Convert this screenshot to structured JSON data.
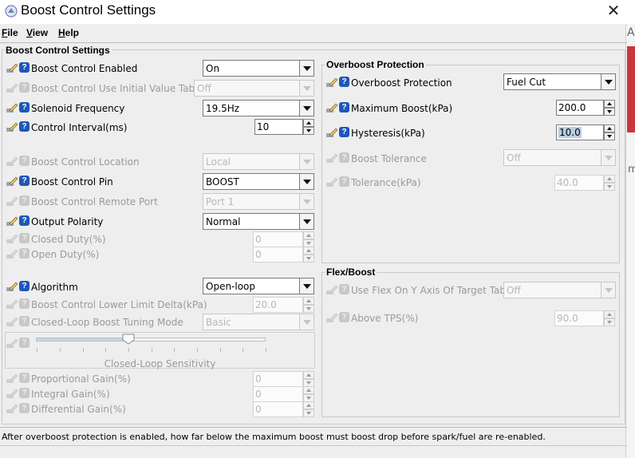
{
  "window": {
    "title": "Boost Control Settings",
    "close_glyph": "✕"
  },
  "menu": [
    {
      "key": "F",
      "rest": "ile"
    },
    {
      "key": "V",
      "rest": "iew"
    },
    {
      "key": "H",
      "rest": "elp"
    }
  ],
  "panel_title": "Boost Control Settings",
  "left": {
    "boost_control_enabled": {
      "label": "Boost Control Enabled",
      "value": "On"
    },
    "use_initial_value_table": {
      "label": "Boost Control Use Initial Value Table",
      "value": "Off"
    },
    "solenoid_frequency": {
      "label": "Solenoid Frequency",
      "value": "19.5Hz"
    },
    "control_interval": {
      "label": "Control Interval(ms)",
      "value": "10"
    },
    "boost_control_location": {
      "label": "Boost Control Location",
      "value": "Local"
    },
    "boost_control_pin": {
      "label": "Boost Control Pin",
      "value": "BOOST"
    },
    "remote_port": {
      "label": "Boost Control Remote Port",
      "value": "Port 1"
    },
    "output_polarity": {
      "label": "Output Polarity",
      "value": "Normal"
    },
    "closed_duty": {
      "label": "Closed Duty(%)",
      "value": "0"
    },
    "open_duty": {
      "label": "Open Duty(%)",
      "value": "0"
    },
    "algorithm": {
      "label": "Algorithm",
      "value": "Open-loop"
    },
    "lower_limit_delta": {
      "label": "Boost Control Lower Limit Delta(kPa)",
      "value": "20.0"
    },
    "tuning_mode": {
      "label": "Closed-Loop Boost Tuning Mode",
      "value": "Basic"
    },
    "sensitivity": {
      "label": "Closed-Loop Sensitivity",
      "level": 0.4
    },
    "proportional_gain": {
      "label": "Proportional Gain(%)",
      "value": "0"
    },
    "integral_gain": {
      "label": "Integral Gain(%)",
      "value": "0"
    },
    "differential_gain": {
      "label": "Differential Gain(%)",
      "value": "0"
    }
  },
  "overboost": {
    "title": "Overboost Protection",
    "protection": {
      "label": "Overboost Protection",
      "value": "Fuel Cut"
    },
    "max_boost": {
      "label": "Maximum Boost(kPa)",
      "value": "200.0"
    },
    "hysteresis": {
      "label": "Hysteresis(kPa)",
      "value": "10.0"
    },
    "boost_tolerance": {
      "label": "Boost Tolerance",
      "value": "Off"
    },
    "tolerance": {
      "label": "Tolerance(kPa)",
      "value": "40.0"
    }
  },
  "flex": {
    "title": "Flex/Boost",
    "use_flex": {
      "label": "Use Flex On Y Axis Of Target Table",
      "value": "Off"
    },
    "above_tps": {
      "label": "Above TPS(%)",
      "value": "90.0"
    }
  },
  "status": "After overboost protection is enabled, how far below the maximum boost must boost drop before spark/fuel are re-enabled.",
  "colors": {
    "help_icon": "#1f57b8",
    "selection": "#b8cfe5",
    "disabled_text": "#9a9a9a"
  }
}
